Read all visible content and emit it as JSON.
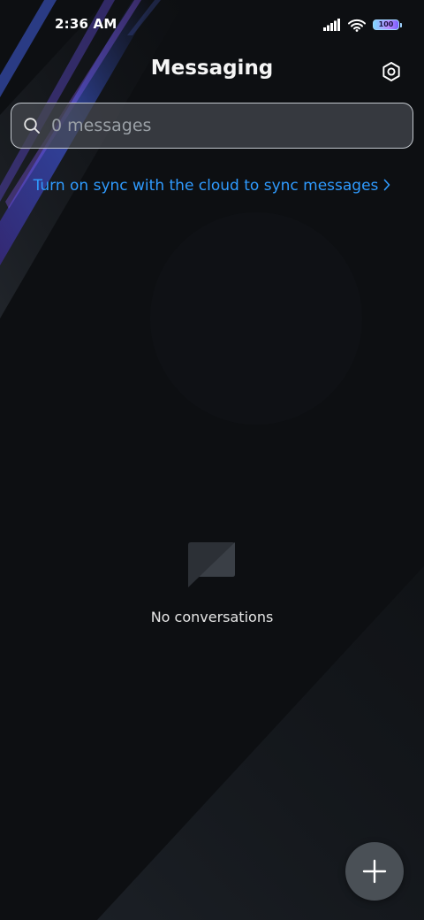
{
  "status_bar": {
    "time": "2:36 AM",
    "battery_level": "100",
    "icons": [
      "signal-icon",
      "wifi-icon",
      "battery-icon"
    ]
  },
  "header": {
    "title": "Messaging",
    "settings_icon": "gear-icon"
  },
  "search": {
    "placeholder": "0 messages",
    "value": ""
  },
  "sync_banner": {
    "label": "Turn on sync with the cloud to sync messages"
  },
  "empty_state": {
    "icon": "chat-bubble-icon",
    "message": "No conversations"
  },
  "fab": {
    "icon": "plus-icon"
  },
  "colors": {
    "background": "#0d0f12",
    "accent_link": "#2f9bff",
    "fab": "#4a5056",
    "search_bg": "#464a50"
  }
}
